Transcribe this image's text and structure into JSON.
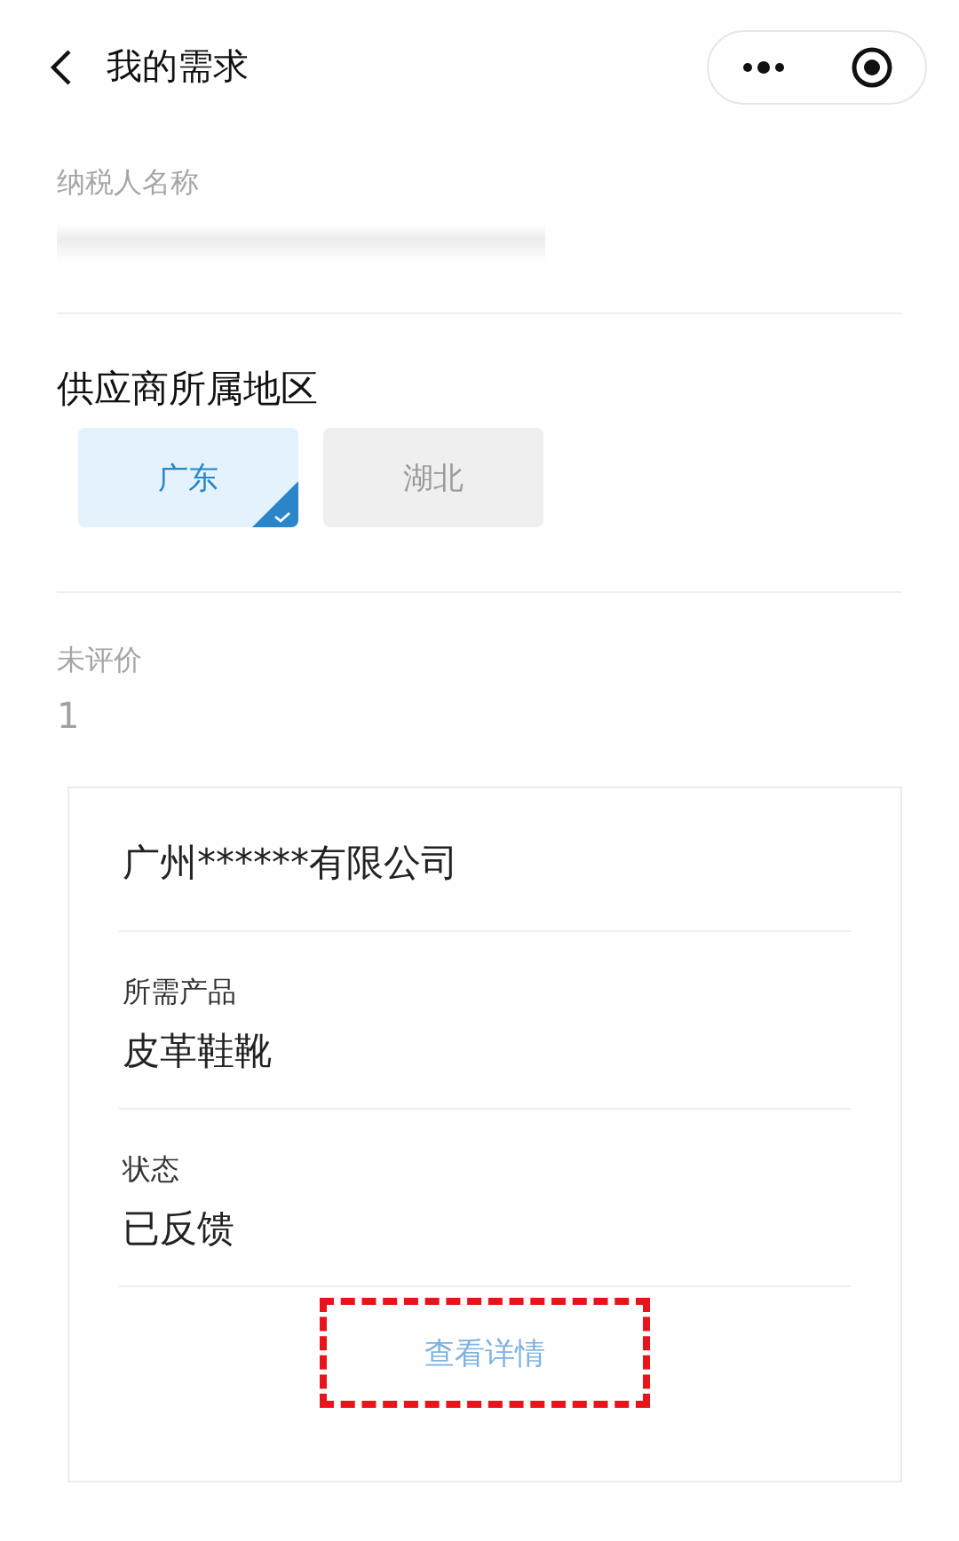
{
  "nav": {
    "title": "我的需求"
  },
  "taxpayer": {
    "label": "纳税人名称",
    "redacted": true
  },
  "region": {
    "title": "供应商所属地区",
    "options": [
      {
        "label": "广东",
        "selected": true
      },
      {
        "label": "湖北",
        "selected": false
      }
    ]
  },
  "unrated": {
    "label": "未评价",
    "value": "1"
  },
  "card": {
    "company": "广州******有限公司",
    "fields": [
      {
        "label": "所需产品",
        "value": "皮革鞋靴"
      },
      {
        "label": "状态",
        "value": "已反馈"
      }
    ],
    "action": "查看详情",
    "highlighted": true
  }
}
